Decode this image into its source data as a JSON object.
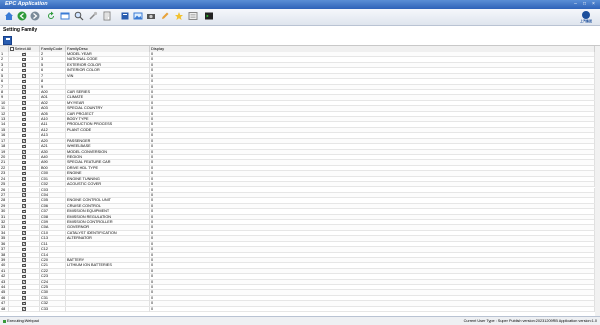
{
  "app": {
    "title": "EPC Application"
  },
  "page": {
    "title": "Setting Family"
  },
  "toolbar": {
    "icons": [
      "home-icon",
      "back-icon",
      "forward-icon",
      "refresh-icon",
      "window-icon",
      "search-icon",
      "tools-icon",
      "catalog-icon",
      "book-icon",
      "image-icon",
      "camera-icon",
      "edit-icon",
      "star-icon",
      "settings-icon",
      "terminal-icon"
    ]
  },
  "logo": {
    "text": "上汽集团"
  },
  "table": {
    "headers": {
      "select": "Select All",
      "code": "FamilyCode",
      "desc": "FamilyDesc",
      "display": "Display"
    },
    "rows": [
      {
        "n": "1",
        "code": "2",
        "desc": "MODEL YEAR",
        "display": "0"
      },
      {
        "n": "2",
        "code": "3",
        "desc": "NATIONAL CODE",
        "display": "0"
      },
      {
        "n": "3",
        "code": "5",
        "desc": "EXTERIOR COLOR",
        "display": "0"
      },
      {
        "n": "4",
        "code": "6",
        "desc": "INTERIOR COLOR",
        "display": "0"
      },
      {
        "n": "5",
        "code": "7",
        "desc": "VIN",
        "display": "0"
      },
      {
        "n": "6",
        "code": "8",
        "desc": "",
        "display": "0"
      },
      {
        "n": "7",
        "code": "9",
        "desc": "",
        "display": "0"
      },
      {
        "n": "8",
        "code": "A00",
        "desc": "CAR SERIES",
        "display": "0"
      },
      {
        "n": "9",
        "code": "A01",
        "desc": "CLIMATE",
        "display": "0"
      },
      {
        "n": "10",
        "code": "A02",
        "desc": "MY/YEAR",
        "display": "0"
      },
      {
        "n": "11",
        "code": "A03",
        "desc": "SPECIAL COUNTRY",
        "display": "0"
      },
      {
        "n": "12",
        "code": "A05",
        "desc": "CAR PROJECT",
        "display": "0"
      },
      {
        "n": "13",
        "code": "A10",
        "desc": "BODY TYPE",
        "display": "0"
      },
      {
        "n": "14",
        "code": "A11",
        "desc": "PRODUCTION PROCESS",
        "display": "0"
      },
      {
        "n": "15",
        "code": "A12",
        "desc": "PLANT CODE",
        "display": "0"
      },
      {
        "n": "16",
        "code": "A13",
        "desc": "",
        "display": "0"
      },
      {
        "n": "17",
        "code": "A20",
        "desc": "PASSENGER",
        "display": "0"
      },
      {
        "n": "18",
        "code": "A21",
        "desc": "WHEELBASE",
        "display": "0"
      },
      {
        "n": "19",
        "code": "A30",
        "desc": "MODEL CONVERSION",
        "display": "0"
      },
      {
        "n": "20",
        "code": "A40",
        "desc": "REGION",
        "display": "0"
      },
      {
        "n": "21",
        "code": "A90",
        "desc": "SPECIAL FEATURE CAR",
        "display": "0"
      },
      {
        "n": "22",
        "code": "B00",
        "desc": "DRIVE HDL TYPE",
        "display": "0"
      },
      {
        "n": "23",
        "code": "C00",
        "desc": "ENGINE",
        "display": "0"
      },
      {
        "n": "24",
        "code": "C01",
        "desc": "ENGINE TUNNING",
        "display": "0"
      },
      {
        "n": "25",
        "code": "C02",
        "desc": "ACOUSTIC COVER",
        "display": "0"
      },
      {
        "n": "26",
        "code": "C03",
        "desc": "",
        "display": "0"
      },
      {
        "n": "27",
        "code": "C04",
        "desc": "",
        "display": "0"
      },
      {
        "n": "28",
        "code": "C05",
        "desc": "ENGINE CONTROL UNIT",
        "display": "0"
      },
      {
        "n": "29",
        "code": "C06",
        "desc": "CRUISE CONTROL",
        "display": "0"
      },
      {
        "n": "30",
        "code": "C07",
        "desc": "EMISSION EQUIPMENT",
        "display": "0"
      },
      {
        "n": "31",
        "code": "C08",
        "desc": "EMISSION REGULATION",
        "display": "0"
      },
      {
        "n": "32",
        "code": "C09",
        "desc": "EMISSION CONTROLLER",
        "display": "0"
      },
      {
        "n": "33",
        "code": "C0A",
        "desc": "GOVERNOR",
        "display": "0"
      },
      {
        "n": "34",
        "code": "C10",
        "desc": "CATALYST IDENTIFICATION",
        "display": "0"
      },
      {
        "n": "35",
        "code": "C13",
        "desc": "ALTERNATOR",
        "display": "0"
      },
      {
        "n": "36",
        "code": "C11",
        "desc": "",
        "display": "0"
      },
      {
        "n": "37",
        "code": "C12",
        "desc": "",
        "display": "0"
      },
      {
        "n": "38",
        "code": "C14",
        "desc": "",
        "display": "0"
      },
      {
        "n": "39",
        "code": "C20",
        "desc": "BATTERY",
        "display": "0"
      },
      {
        "n": "40",
        "code": "C21",
        "desc": "LITHIUM ION BATTERIES",
        "display": "0"
      },
      {
        "n": "41",
        "code": "C22",
        "desc": "",
        "display": "0"
      },
      {
        "n": "42",
        "code": "C23",
        "desc": "",
        "display": "0"
      },
      {
        "n": "43",
        "code": "C24",
        "desc": "",
        "display": "0"
      },
      {
        "n": "44",
        "code": "C25",
        "desc": "",
        "display": "0"
      },
      {
        "n": "45",
        "code": "C30",
        "desc": "",
        "display": "0"
      },
      {
        "n": "46",
        "code": "C31",
        "desc": "",
        "display": "0"
      },
      {
        "n": "47",
        "code": "C32",
        "desc": "",
        "display": "0"
      },
      {
        "n": "48",
        "code": "C33",
        "desc": "",
        "display": "0"
      }
    ]
  },
  "status": {
    "left": "Executing:Webpad",
    "right": "Current User Type : Super   Publish version:20231209RB   Application version:1.0"
  }
}
